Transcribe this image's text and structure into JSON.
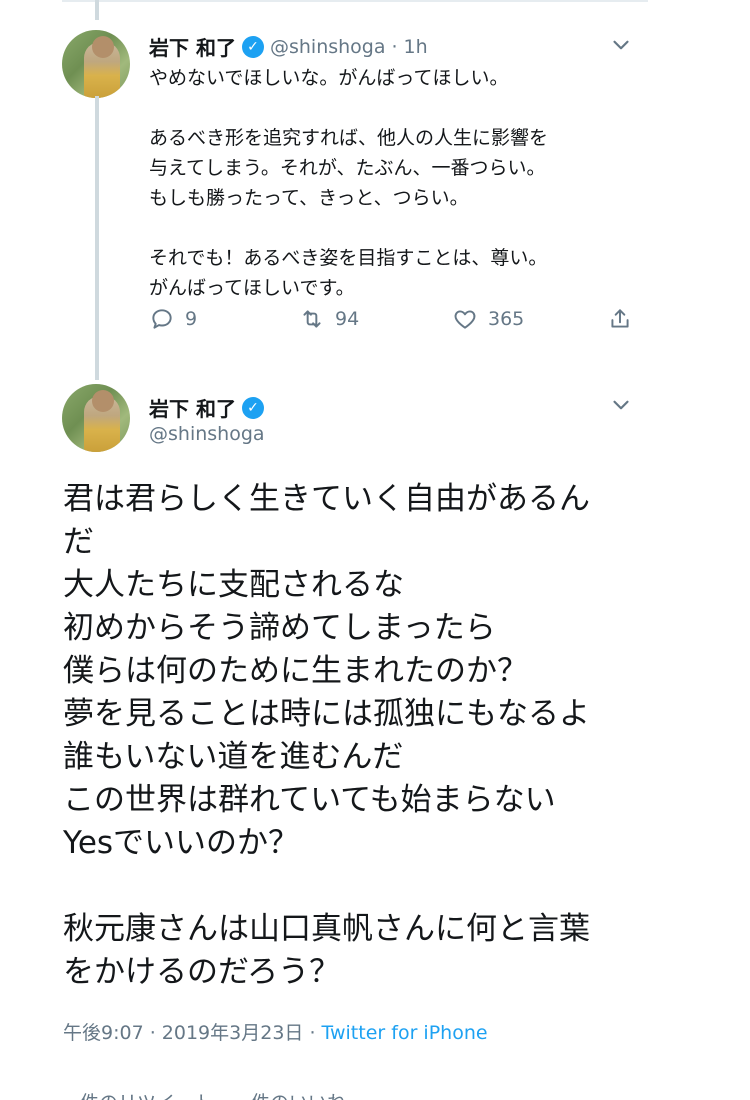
{
  "reply_tweet": {
    "author_name": "岩下 和了",
    "verified_icon": "✓",
    "handle": "@shinshoga",
    "separator": "·",
    "time": "1h",
    "lines": [
      "やめないでほしいな。がんばってほしい。",
      "",
      "あるべき形を追究すれば、他人の人生に影響を",
      "与えてしまう。それが、たぶん、一番つらい。",
      "もしも勝ったって、きっと、つらい。",
      "",
      "それでも！あるべき姿を目指すことは、尊い。",
      "がんばってほしいです。"
    ],
    "reply_count": "9",
    "retweet_count": "94",
    "like_count": "365"
  },
  "main_tweet": {
    "author_name": "岩下 和了",
    "verified_icon": "✓",
    "handle": "@shinshoga",
    "lines": [
      "君は君らしく生きていく自由があるん",
      "だ",
      "大人たちに支配されるな",
      "初めからそう諦めてしまったら",
      "僕らは何のために生まれたのか？",
      "夢を見ることは時には孤独にもなるよ",
      "誰もいない道を進むんだ",
      "この世界は群れていても始まらない",
      "Yesでいいのか？",
      "",
      "秋元康さんは山口真帆さんに何と言葉",
      "をかけるのだろう？"
    ],
    "timestamp": "午後9:07 · 2019年3月23日 · ",
    "source": "Twitter for iPhone"
  },
  "cutoff_text": "件のリツイート　　件のいいね",
  "icons": {
    "reply": "reply-icon",
    "retweet": "retweet-icon",
    "like": "heart-icon",
    "share": "share-icon",
    "menu": "chevron-down-icon"
  },
  "colors": {
    "text": "#14171a",
    "secondary": "#657786",
    "link": "#1da1f2",
    "verified": "#1da1f2"
  }
}
